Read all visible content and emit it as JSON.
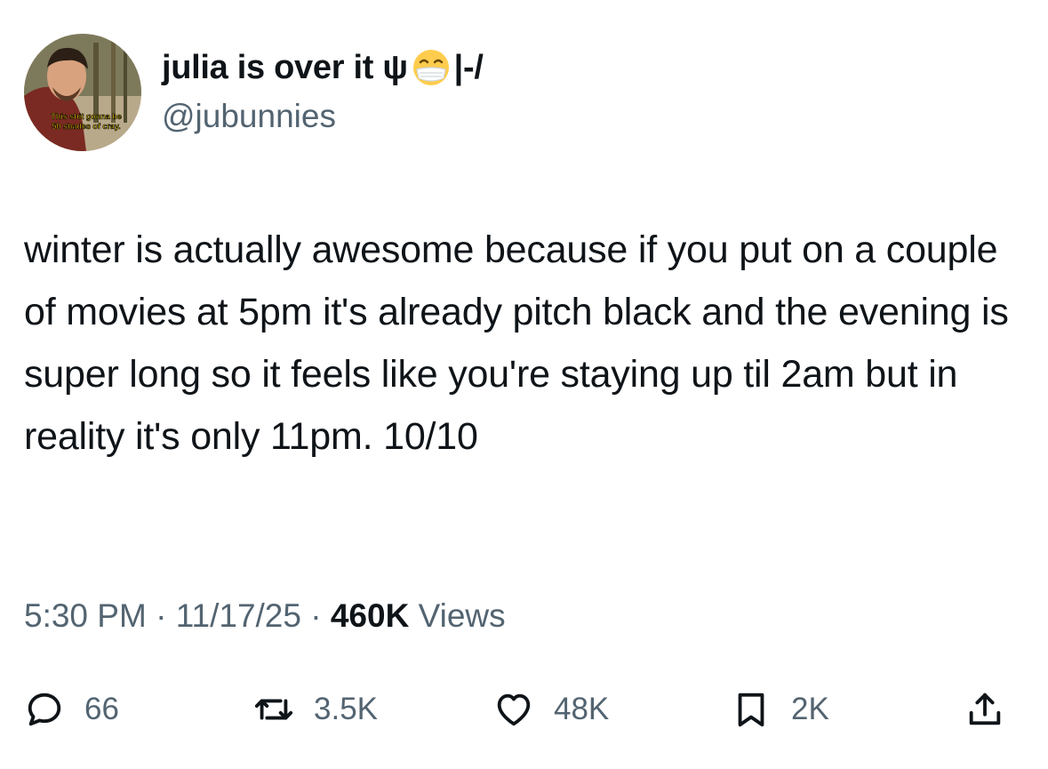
{
  "author": {
    "display_name": "julia is over it ψ",
    "name_suffix": "|-/",
    "handle": "@jubunnies",
    "avatar_caption_line1": "This shit gonna be",
    "avatar_caption_line2": "50 shades of cray.",
    "icons": {
      "name_emoji": "face-with-medical-mask-icon"
    }
  },
  "tweet": {
    "text": "winter is actually awesome because if you put on a couple of movies at 5pm it's already pitch black and the evening is super long so it feels like you're staying up til 2am but in reality it's only 11pm. 10/10",
    "time": "5:30 PM",
    "separator": "·",
    "date": "11/17/25",
    "views_count": "460K",
    "views_label": "Views"
  },
  "actions": {
    "replies": {
      "count": "66",
      "icon": "reply-icon"
    },
    "reposts": {
      "count": "3.5K",
      "icon": "repost-icon"
    },
    "likes": {
      "count": "48K",
      "icon": "heart-icon"
    },
    "bookmarks": {
      "count": "2K",
      "icon": "bookmark-icon"
    },
    "share": {
      "icon": "share-icon"
    }
  },
  "colors": {
    "text_primary": "#0f1419",
    "text_secondary": "#536471",
    "background": "#ffffff"
  }
}
